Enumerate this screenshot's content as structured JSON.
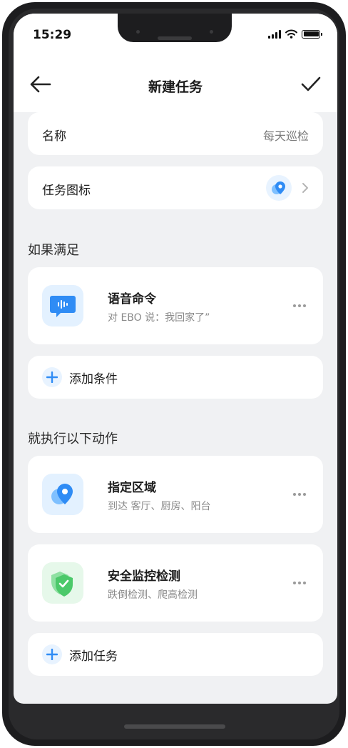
{
  "status_bar": {
    "time": "15:29"
  },
  "navbar": {
    "title": "新建任务",
    "back_icon": "arrow-left-icon",
    "confirm_icon": "checkmark-icon"
  },
  "name_row": {
    "label": "名称",
    "value": "每天巡检"
  },
  "icon_row": {
    "label": "任务图标",
    "icon": "location-pin-icon"
  },
  "conditions": {
    "title": "如果满足",
    "items": [
      {
        "title": "语音命令",
        "subtitle": "对 EBO 说：我回家了”",
        "icon": "voice-message-icon"
      }
    ],
    "add_label": "添加条件"
  },
  "actions": {
    "title": "就执行以下动作",
    "items": [
      {
        "title": "指定区域",
        "subtitle": "到达 客厅、厨房、阳台",
        "icon": "location-pin-icon"
      },
      {
        "title": "安全监控检测",
        "subtitle": "跌倒检测、爬高检测",
        "icon": "shield-check-icon"
      }
    ],
    "add_label": "添加任务"
  },
  "colors": {
    "accent": "#2f8cf5",
    "accent_light": "#e8f3ff",
    "green": "#4cc96a",
    "background": "#f0f1f3"
  }
}
